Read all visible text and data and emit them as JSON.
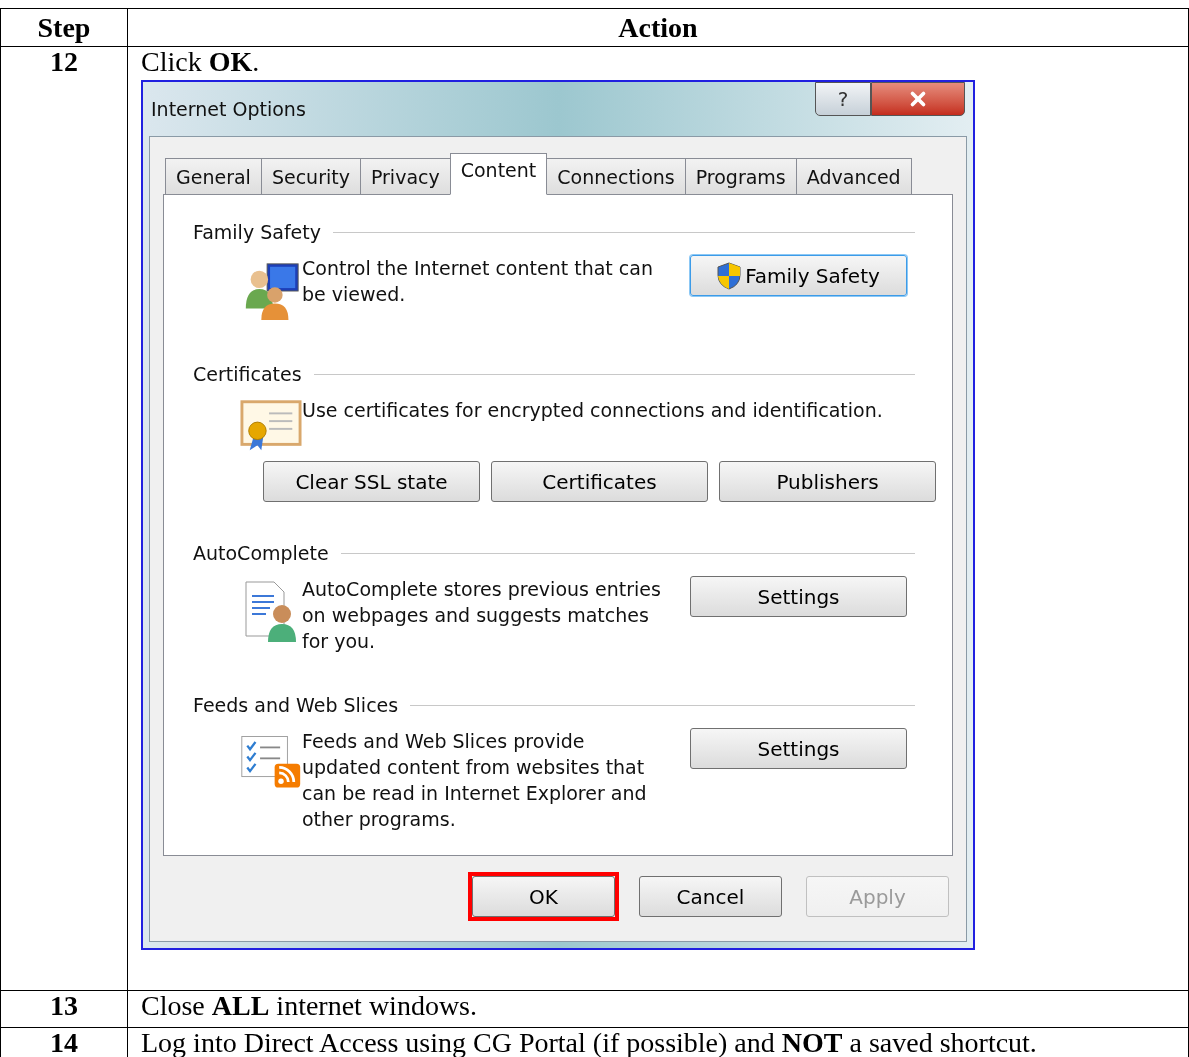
{
  "table": {
    "columns": [
      "Step",
      "Action"
    ],
    "rows": [
      {
        "step": "12",
        "action": "Click **OK**.",
        "dialog": {
          "title": "Internet Options",
          "help_button": "?",
          "tabs": [
            {
              "label": "General",
              "selected": false
            },
            {
              "label": "Security",
              "selected": false
            },
            {
              "label": "Privacy",
              "selected": false
            },
            {
              "label": "Content",
              "selected": true
            },
            {
              "label": "Connections",
              "selected": false
            },
            {
              "label": "Programs",
              "selected": false
            },
            {
              "label": "Advanced",
              "selected": false
            }
          ],
          "sections": [
            {
              "kind": "family",
              "title": "Family Safety",
              "description": "Control the Internet content that can be viewed.",
              "buttons": [
                {
                  "label": "Family Safety",
                  "focused": true,
                  "shield": true
                }
              ]
            },
            {
              "kind": "certificates",
              "title": "Certificates",
              "description": "Use certificates for encrypted connections and identification.",
              "buttons": [
                {
                  "label": "Clear SSL state",
                  "focused": false,
                  "shield": false
                },
                {
                  "label": "Certificates",
                  "focused": false,
                  "shield": false
                },
                {
                  "label": "Publishers",
                  "focused": false,
                  "shield": false
                }
              ]
            },
            {
              "kind": "autocomplete",
              "title": "AutoComplete",
              "description": "AutoComplete stores previous entries on webpages and suggests matches for you.",
              "buttons": [
                {
                  "label": "Settings",
                  "focused": false,
                  "shield": false
                }
              ]
            },
            {
              "kind": "feeds",
              "title": "Feeds and Web Slices",
              "description": "Feeds and Web Slices provide updated content from websites that can be read in Internet Explorer and other programs.",
              "buttons": [
                {
                  "label": "Settings",
                  "focused": false,
                  "shield": false
                }
              ]
            }
          ],
          "footer_buttons": [
            {
              "label": "OK",
              "disabled": false,
              "highlighted": true
            },
            {
              "label": "Cancel",
              "disabled": false,
              "highlighted": false
            },
            {
              "label": "Apply",
              "disabled": true,
              "highlighted": false
            }
          ]
        }
      },
      {
        "step": "13",
        "action": "Close **ALL** internet windows."
      },
      {
        "step": "14",
        "action": "Log into Direct Access using CG Portal (if possible) and **NOT** a saved shortcut."
      }
    ]
  }
}
